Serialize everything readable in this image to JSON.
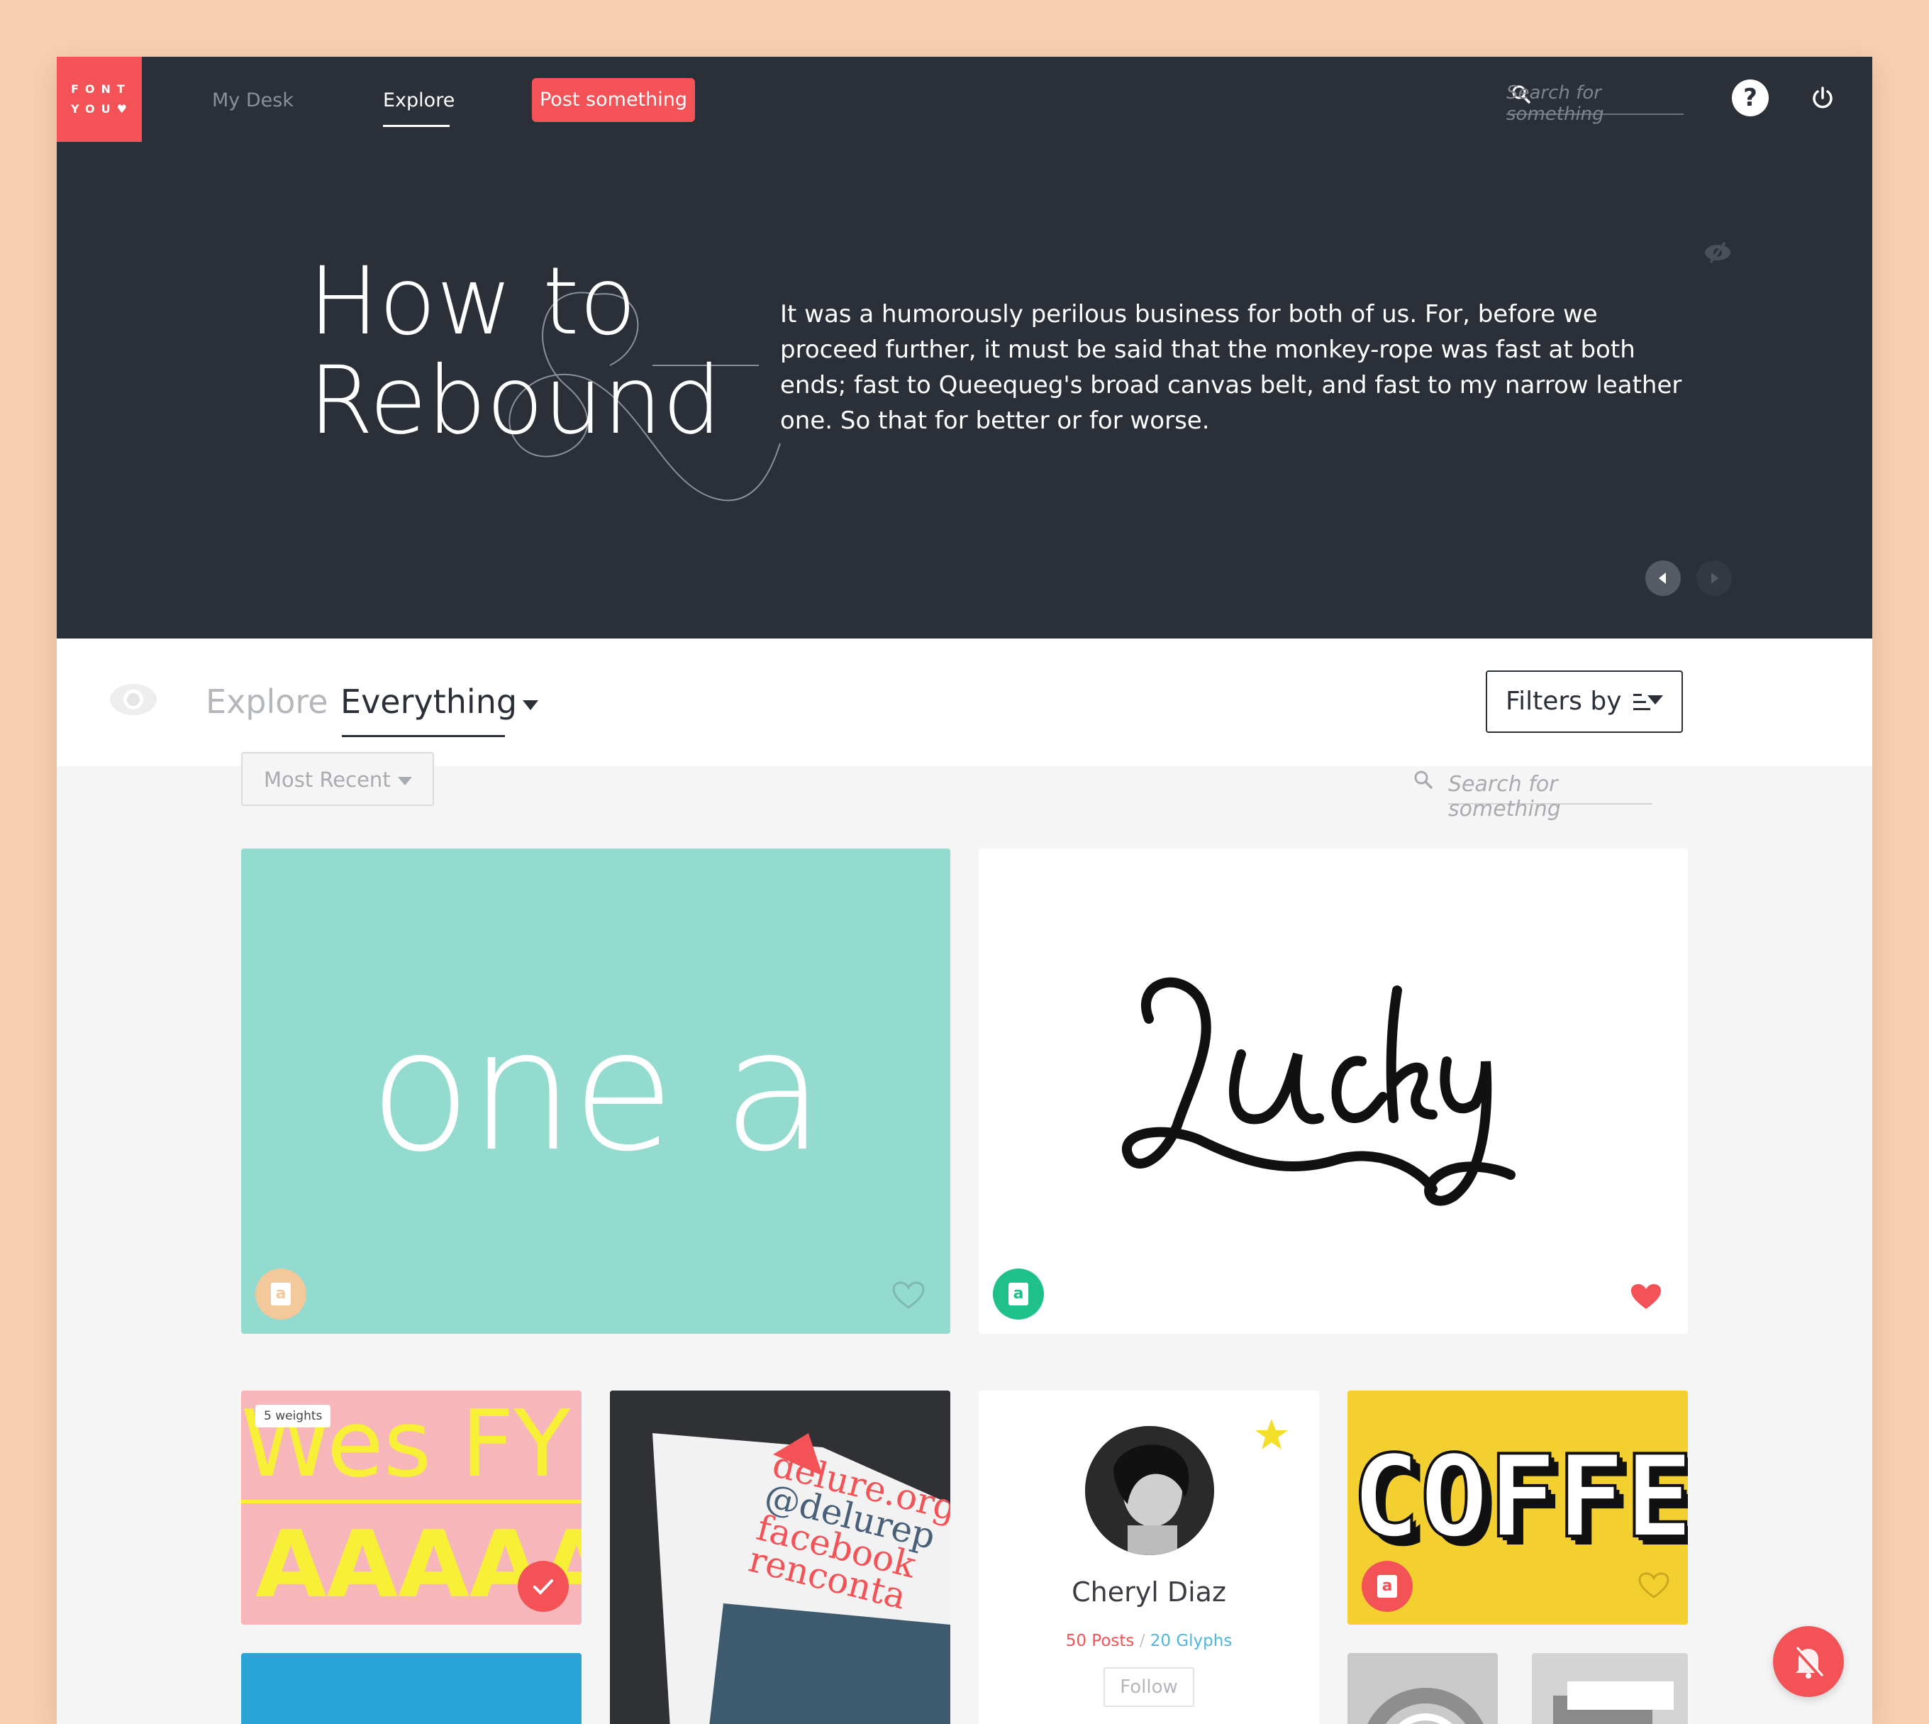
{
  "nav": {
    "logo_line1": "FONT",
    "logo_line2": "YOU",
    "links": [
      {
        "label": "My Desk",
        "active": false
      },
      {
        "label": "Explore",
        "active": true
      }
    ],
    "post_button": "Post something",
    "search_placeholder": "Search for something"
  },
  "hero": {
    "title_line1": "How to",
    "title_line2": "Rebound",
    "body": "It was a humorously perilous business for both of us. For, before we proceed further, it must be said that the monkey-rope was fast at both ends; fast to Queequeg's broad canvas belt, and fast to my narrow leather one. So that for better or for worse."
  },
  "explore_bar": {
    "label": "Explore",
    "value": "Everything",
    "filters_button": "Filters by"
  },
  "content": {
    "sort": "Most Recent",
    "search_placeholder": "Search for something"
  },
  "cards": {
    "onea": {
      "text": "one a",
      "liked": false
    },
    "lucky": {
      "text": "Lucky",
      "liked": true
    },
    "wes": {
      "badge": "5 weights",
      "top": "Wes FY",
      "bottom": "AAAAA"
    },
    "photo": {
      "lines": [
        "delure.org",
        "@delurep",
        "facebook",
        "renconta"
      ]
    },
    "profile": {
      "name": "Cheryl Diaz",
      "posts": "50 Posts",
      "separator": "/",
      "glyphs": "20 Glyphs",
      "follow": "Follow"
    },
    "coffee": {
      "text": "COFFE"
    }
  },
  "colors": {
    "accent": "#f35256",
    "dark": "#2b2f37",
    "mint": "#93dbcf",
    "yellow": "#f3cf2f",
    "pink": "#f7b7ba"
  }
}
